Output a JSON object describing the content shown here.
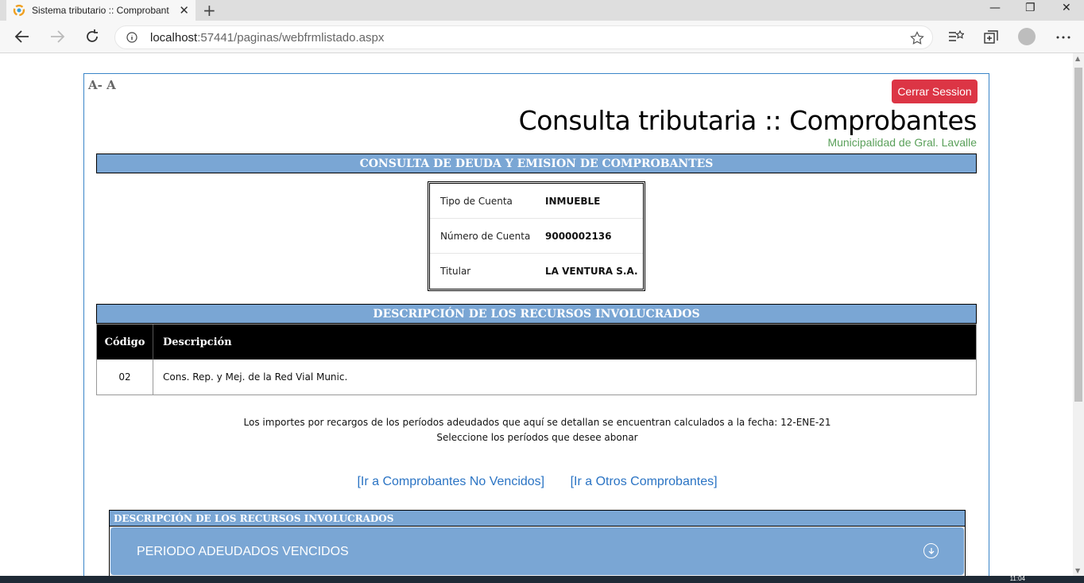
{
  "browser": {
    "tab_title": "Sistema tributario :: Comprobant",
    "tab_close": "✕",
    "new_tab": "+",
    "url_host": "localhost",
    "url_rest": ":57441/paginas/webfrmlistado.aspx",
    "minimize": "—",
    "restore": "❐",
    "close": "✕"
  },
  "page": {
    "font_controls": "A- A",
    "logout_label": "Cerrar Session",
    "title": "Consulta tributaria :: Comprobantes",
    "subtitle": "Municipalidad de Gral. Lavalle",
    "section1_title": "CONSULTA DE DEUDA Y EMISION DE COMPROBANTES",
    "account": [
      {
        "label": "Tipo de Cuenta",
        "value": "INMUEBLE"
      },
      {
        "label": "Número de Cuenta",
        "value": "9000002136"
      },
      {
        "label": "Titular",
        "value": "LA VENTURA S.A."
      }
    ],
    "section2_title": "DESCRIPCIÓN DE LOS RECURSOS INVOLUCRADOS",
    "resources": {
      "headers": [
        "Código",
        "Descripción"
      ],
      "rows": [
        [
          "02",
          "Cons. Rep. y Mej. de la Red Vial Munic."
        ]
      ]
    },
    "note_line1": "Los importes por recargos de los períodos adeudados que aquí se detallan se encuentran calculados a la fecha: 12-ENE-21",
    "note_line2": "Seleccione los períodos que desee abonar",
    "link1": "[Ir a Comprobantes No Vencidos]",
    "link2": "[Ir a Otros Comprobantes]",
    "panel_title": "DESCRIPCIÓN DE LOS RECURSOS INVOLUCRADOS",
    "accordion_title": "PERIODO ADEUDADOS VENCIDOS"
  },
  "taskbar": {
    "clock": "11:04"
  },
  "colors": {
    "band": "#7aa6d4",
    "logout": "#dc3545",
    "subtitle": "#5aa05a",
    "link": "#2b74c4",
    "frame_border": "#3a85c8"
  }
}
